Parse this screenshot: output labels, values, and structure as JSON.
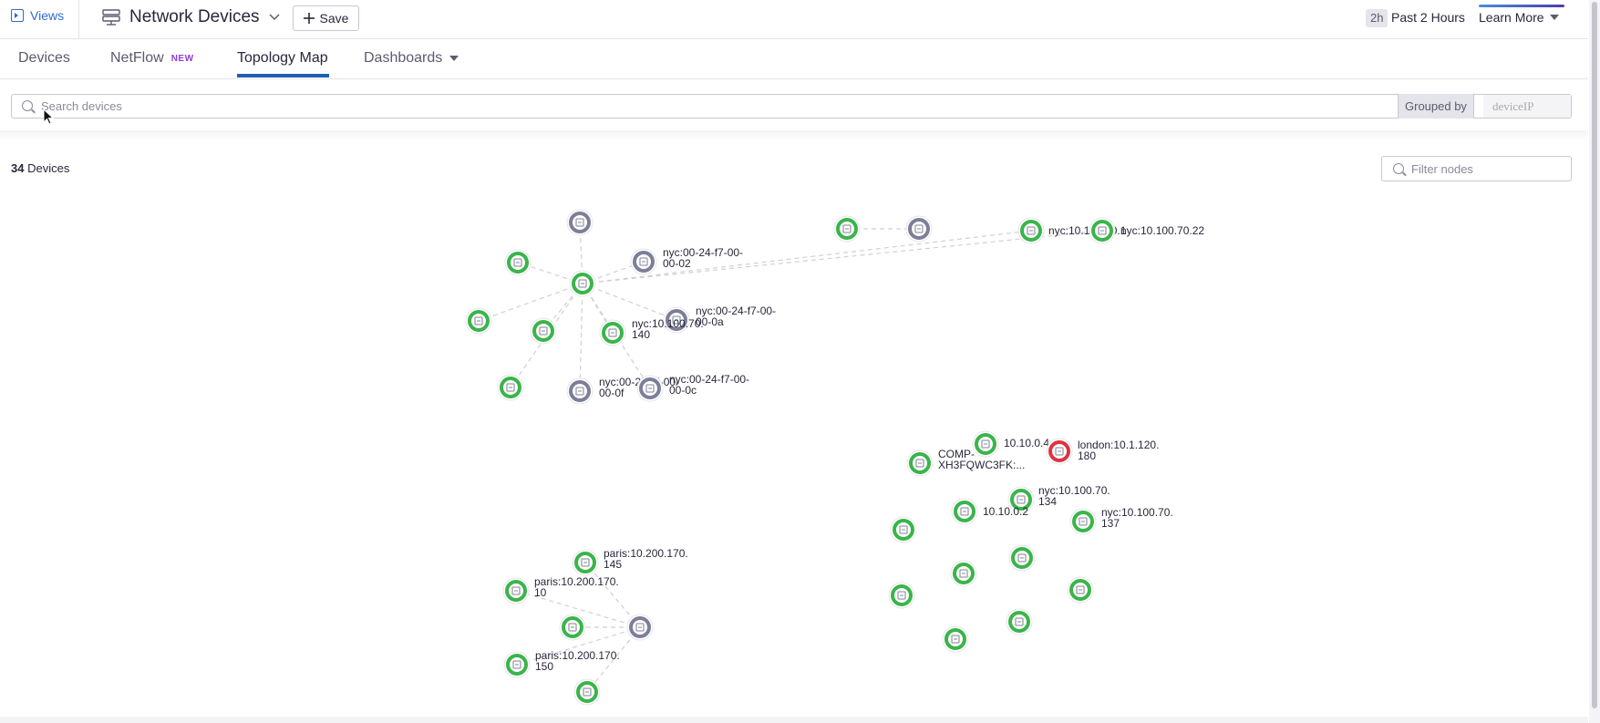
{
  "header": {
    "views_label": "Views",
    "page_title": "Network Devices",
    "save_label": "Save",
    "time_abbrev": "2h",
    "time_label": "Past 2 Hours",
    "learn_more_label": "Learn More"
  },
  "tabs": [
    {
      "label": "Devices",
      "active": false
    },
    {
      "label": "NetFlow",
      "badge": "NEW",
      "active": false
    },
    {
      "label": "Topology Map",
      "active": true
    },
    {
      "label": "Dashboards",
      "active": false
    }
  ],
  "search": {
    "placeholder": "Search devices",
    "grouped_by_label": "Grouped by",
    "grouped_by_value": "deviceIP"
  },
  "summary": {
    "count": "34",
    "count_suffix": "Devices"
  },
  "filter": {
    "placeholder": "Filter nodes"
  },
  "colors": {
    "node_ok": "#3ab54a",
    "node_unmonitored": "#7c7f98",
    "node_alert": "#e0323f",
    "accent": "#1f5fb5",
    "new_badge": "#8d3cd6"
  },
  "topology": {
    "nodes": [
      {
        "id": "n1",
        "status": "unmonitored",
        "label": []
      },
      {
        "id": "n2",
        "status": "ok",
        "label": []
      },
      {
        "id": "n3",
        "status": "ok",
        "label": []
      },
      {
        "id": "n4",
        "status": "unmonitored",
        "label": [
          "nyc:00-24-f7-00-",
          "00-02"
        ]
      },
      {
        "id": "n5",
        "status": "ok",
        "label": []
      },
      {
        "id": "n6",
        "status": "ok",
        "label": []
      },
      {
        "id": "n7",
        "status": "unmonitored",
        "label": [
          "nyc:00-24-f7-00-",
          "00-0a"
        ]
      },
      {
        "id": "n8",
        "status": "ok",
        "label": [
          "nyc:10.100.70.",
          "140"
        ]
      },
      {
        "id": "n9",
        "status": "ok",
        "label": []
      },
      {
        "id": "n10",
        "status": "unmonitored",
        "label": [
          "nyc:00-24-f7-00-",
          "00-0f"
        ]
      },
      {
        "id": "n11",
        "status": "unmonitored",
        "label": [
          "nyc:00-24-f7-00-",
          "00-0c"
        ]
      },
      {
        "id": "n12",
        "status": "ok",
        "label": []
      },
      {
        "id": "n13",
        "status": "unmonitored",
        "label": []
      },
      {
        "id": "n14",
        "status": "ok",
        "label": [
          "nyc:10.100.70.1"
        ]
      },
      {
        "id": "n15",
        "status": "ok",
        "label": [
          "nyc:10.100.70.22"
        ]
      },
      {
        "id": "n16",
        "status": "ok",
        "label": [
          "10.10.0.4"
        ]
      },
      {
        "id": "n17",
        "status": "alert",
        "label": [
          "london:10.1.120.",
          "180"
        ]
      },
      {
        "id": "n18",
        "status": "ok",
        "label": [
          "COMP-",
          "XH3FQWC3FK:..."
        ]
      },
      {
        "id": "n19",
        "status": "ok",
        "label": [
          "nyc:10.100.70.",
          "134"
        ]
      },
      {
        "id": "n20",
        "status": "ok",
        "label": [
          "10.10.0.2"
        ]
      },
      {
        "id": "n21",
        "status": "ok",
        "label": [
          "nyc:10.100.70.",
          "137"
        ]
      },
      {
        "id": "n22",
        "status": "ok",
        "label": []
      },
      {
        "id": "n23",
        "status": "ok",
        "label": []
      },
      {
        "id": "n24",
        "status": "ok",
        "label": []
      },
      {
        "id": "n25",
        "status": "ok",
        "label": []
      },
      {
        "id": "n26",
        "status": "ok",
        "label": []
      },
      {
        "id": "n27",
        "status": "ok",
        "label": []
      },
      {
        "id": "n28",
        "status": "ok",
        "label": []
      },
      {
        "id": "n29",
        "status": "ok",
        "label": [
          "paris:10.200.170.",
          "145"
        ]
      },
      {
        "id": "n30",
        "status": "ok",
        "label": [
          "paris:10.200.170.",
          "10"
        ]
      },
      {
        "id": "n31",
        "status": "ok",
        "label": []
      },
      {
        "id": "n32",
        "status": "unmonitored",
        "label": []
      },
      {
        "id": "n33",
        "status": "ok",
        "label": [
          "paris:10.200.170.",
          "150"
        ]
      },
      {
        "id": "n34",
        "status": "ok",
        "label": []
      }
    ],
    "links": [
      [
        "n3",
        "n1"
      ],
      [
        "n3",
        "n2"
      ],
      [
        "n3",
        "n4"
      ],
      [
        "n3",
        "n5"
      ],
      [
        "n3",
        "n6"
      ],
      [
        "n3",
        "n7"
      ],
      [
        "n3",
        "n8"
      ],
      [
        "n3",
        "n9"
      ],
      [
        "n3",
        "n10"
      ],
      [
        "n3",
        "n11"
      ],
      [
        "n3",
        "n14"
      ],
      [
        "n3",
        "n15"
      ],
      [
        "n12",
        "n13"
      ],
      [
        "n32",
        "n29"
      ],
      [
        "n32",
        "n30"
      ],
      [
        "n32",
        "n31"
      ],
      [
        "n32",
        "n33"
      ],
      [
        "n32",
        "n34"
      ]
    ]
  }
}
